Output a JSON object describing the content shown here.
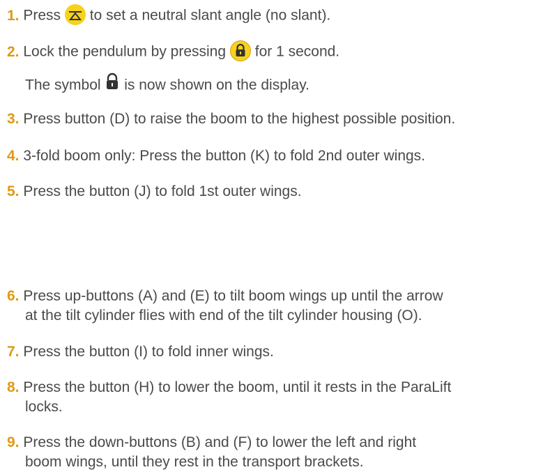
{
  "steps": [
    {
      "num": "1.",
      "pre": "Press",
      "post": "to set a neutral slant angle (no slant)."
    },
    {
      "num": "2.",
      "pre": "Lock the pendulum by pressing",
      "post": "for 1 second.",
      "sub_pre": "The symbol",
      "sub_post": "is now shown on the display."
    },
    {
      "num": "3.",
      "text": "Press button (D) to raise the boom to the highest possible position."
    },
    {
      "num": "4.",
      "text": "3-fold boom only: Press the button (K) to fold 2nd outer wings."
    },
    {
      "num": "5.",
      "text": "Press the button (J) to fold 1st outer wings."
    },
    {
      "num": "6.",
      "line1": "Press up-buttons (A) and (E) to tilt boom wings up until the arrow",
      "line2": "at the tilt cylinder flies with end of the tilt cylinder housing (O)."
    },
    {
      "num": "7.",
      "text": "Press the button (I) to fold inner wings."
    },
    {
      "num": "8.",
      "line1": "Press the button (H) to lower the boom, until it rests in the ParaLift",
      "line2": "locks."
    },
    {
      "num": "9.",
      "line1": "Press the down-buttons (B) and (F) to lower the left and right",
      "line2": "boom wings, until they rest in the transport brackets."
    }
  ],
  "icons": {
    "neutral": "neutral-slant-icon",
    "lock_button": "lock-button-icon",
    "lock_symbol": "lock-symbol-icon",
    "accent": "#f7d21c",
    "number_color": "#e09a12"
  }
}
